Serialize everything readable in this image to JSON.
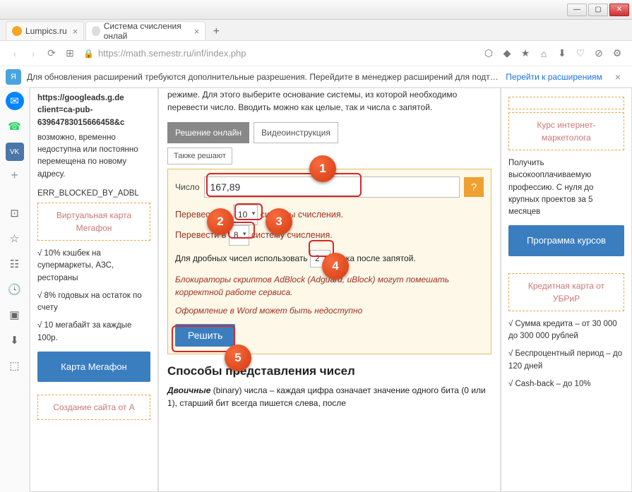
{
  "window": {
    "min": "—",
    "max": "▢",
    "close": "✕"
  },
  "tabs": {
    "t1": "Lumpics.ru",
    "t2": "Система счисления онлай",
    "close": "×",
    "plus": "+"
  },
  "addr": {
    "back": "‹",
    "fwd": "›",
    "reload": "⟳",
    "speed": "⊞",
    "url": "https://math.semestr.ru/inf/index.php"
  },
  "ext": {
    "icon": "Я",
    "text": "Для обновления расширений требуются дополнительные разрешения. Перейдите в менеджер расширений для подтвер…",
    "go": "Перейти к расширениям",
    "close": "×"
  },
  "left": {
    "line1": "https://googleads.g.de",
    "line2": "client=ca-pub-",
    "line3": "63964783015666458&c",
    "err1": "возможно, временно недоступна или постоянно перемещена по новому адресу.",
    "err2": "ERR_BLOCKED_BY_ADBL",
    "box1": "Виртуальная карта Мегафон",
    "b1": "√ 10% кэшбек на супермаркеты, АЗС, рестораны",
    "b2": "√ 8% годовых на остаток по счету",
    "b3": "√ 10 мегабайт за каждые 100р.",
    "btn": "Карта Мегафон",
    "box2": "Создание сайта от А"
  },
  "center": {
    "intro": "режиме. Для этого выберите основание системы, из которой необходимо перевести число. Вводить можно как целые, так и числа с запятой.",
    "tab1": "Решение онлайн",
    "tab2": "Видеоинструкция",
    "tab3": "Также решают",
    "lbl_num": "Число",
    "num_val": "167,89",
    "help": "?",
    "line_from_a": "Перевести из ",
    "sel1": "10",
    "line_from_b": " системы счисления.",
    "line_to_a": "Перевести в ",
    "sel2": "8",
    "line_to_b": " систему счисления.",
    "frac_a": "Для дробных чисел использовать ",
    "sel3": "2",
    "frac_b": " знака после запятой.",
    "warn1": "Блокираторы скриптов AdBlock (Adguard, uBlock) могут помешать корректной работе сервиса.",
    "warn2": "Оформление в Word может быть недоступно",
    "solve": "Решить",
    "h2": "Способы представления чисел",
    "body": "Двоичные (binary) числа – каждая цифра означает значение одного бита (0 или 1), старший бит всегда пишется слева, после"
  },
  "right": {
    "box1": "Курс интернет-маркетолога",
    "t1": "Получить высокооплачиваемую профессию. С нуля до крупных проектов за 5 месяцев",
    "btn1": "Программа курсов",
    "box2": "Кредитная карта от УБРиР",
    "r1": "√ Сумма кредита – от 30 000 до 300 000 рублей",
    "r2": "√ Беспроцентный период – до 120 дней",
    "r3": "√ Cash-back – до 10%"
  },
  "ann": {
    "a1": "1",
    "a2": "2",
    "a3": "3",
    "a4": "4",
    "a5": "5"
  }
}
